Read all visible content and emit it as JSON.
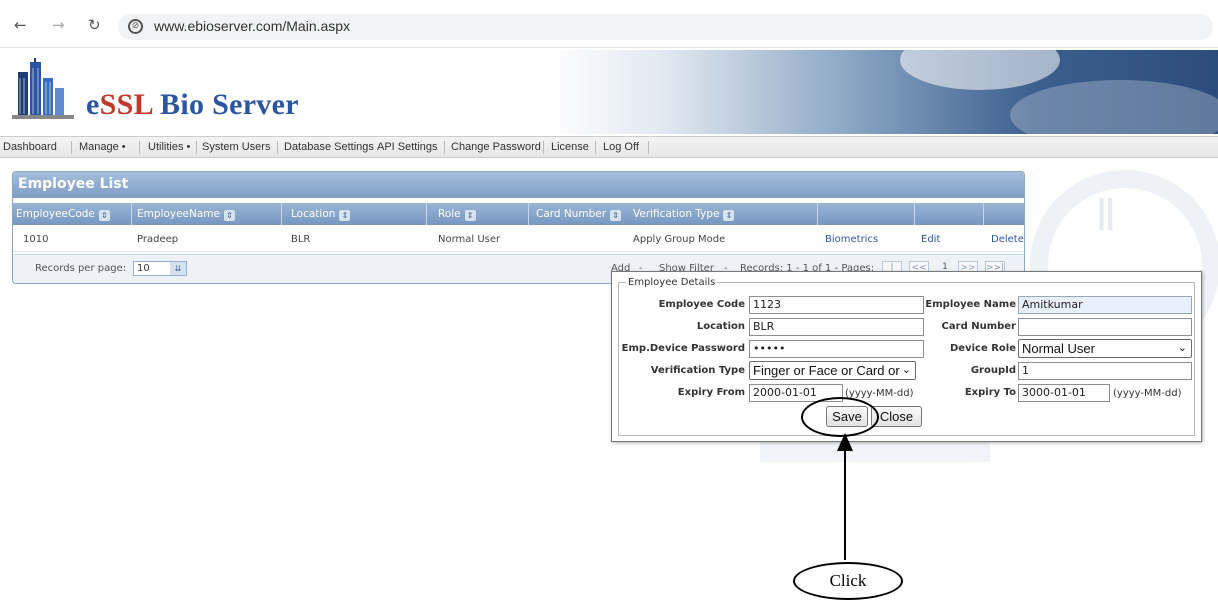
{
  "browser": {
    "url": "www.ebioserver.com/Main.aspx",
    "back_icon": "back-arrow-icon",
    "forward_icon": "forward-arrow-icon",
    "reload_icon": "reload-icon",
    "site_icon": "site-info-icon"
  },
  "app": {
    "logo_prefix": "e",
    "logo_accent": "SSL",
    "logo_rest": " Bio Server",
    "brand_color": "#2b55a0",
    "accent_color": "#c0392b"
  },
  "menu": {
    "items": [
      "Dashboard",
      "Manage •",
      "Utilities •",
      "System Users",
      "Database Settings",
      "API Settings",
      "Change Password",
      "License",
      "Log Off"
    ]
  },
  "employee_list": {
    "title": "Employee List",
    "columns": [
      "EmployeeCode",
      "EmployeeName",
      "Location",
      "Role",
      "Card Number",
      "Verification Type"
    ],
    "rows": [
      {
        "code": "1010",
        "name": "Pradeep",
        "location": "BLR",
        "role": "Normal User",
        "card_number": "",
        "verification_type": "Apply Group Mode",
        "biometrics": "Biometrics",
        "edit": "Edit",
        "delete": "Delete"
      }
    ],
    "footer": {
      "records_per_page_label": "Records per page:",
      "records_per_page_value": "10",
      "add": "Add",
      "sep1": "-",
      "show_filter": "Show Filter",
      "sep2": "-",
      "records_info": "Records: 1 - 1 of 1 - Pages:",
      "pager_first": "|<<",
      "pager_prev": "<<",
      "current_page": "1",
      "pager_next": ">>",
      "pager_last": ">>|"
    }
  },
  "employee_details": {
    "legend": "Employee Details",
    "employee_code_label": "Employee Code",
    "employee_code_value": "1123",
    "employee_name_label": "Employee Name",
    "employee_name_value": "Amitkumar",
    "location_label": "Location",
    "location_value": "BLR",
    "card_number_label": "Card Number",
    "card_number_value": "",
    "device_password_label": "Emp.Device Password",
    "device_password_value": "•••••",
    "device_role_label": "Device Role",
    "device_role_value": "Normal User",
    "verification_type_label": "Verification Type",
    "verification_type_value": "Finger or Face or Card or",
    "group_id_label": "GroupId",
    "group_id_value": "1",
    "expiry_from_label": "Expiry From",
    "expiry_from_value": "2000-01-01",
    "expiry_from_hint": "(yyyy-MM-dd)",
    "expiry_to_label": "Expiry To",
    "expiry_to_value": "3000-01-01",
    "expiry_to_hint": "(yyyy-MM-dd)",
    "save_label": "Save",
    "close_label": "Close"
  },
  "annotation": {
    "label": "Click"
  }
}
